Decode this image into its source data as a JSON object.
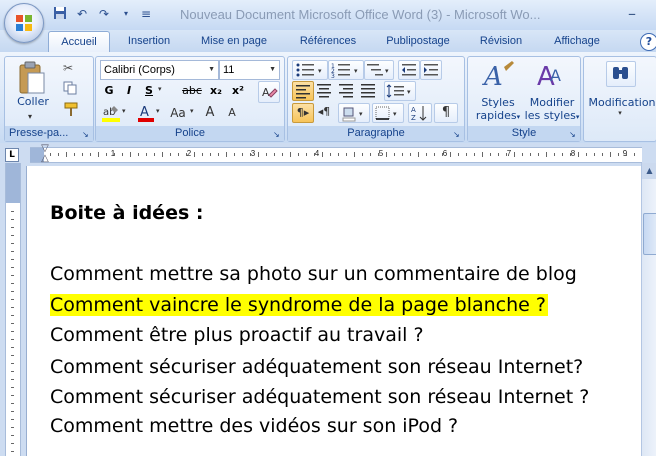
{
  "window": {
    "title": "Nouveau Document Microsoft Office Word (3) - Microsoft Wo...",
    "minimize": "–"
  },
  "quick_access": [
    "save-icon",
    "undo-icon",
    "redo-icon",
    "customize-icon"
  ],
  "tabs": [
    {
      "label": "Accueil",
      "active": true
    },
    {
      "label": "Insertion",
      "active": false
    },
    {
      "label": "Mise en page",
      "active": false
    },
    {
      "label": "Références",
      "active": false
    },
    {
      "label": "Publipostage",
      "active": false
    },
    {
      "label": "Révision",
      "active": false
    },
    {
      "label": "Affichage",
      "active": false
    }
  ],
  "help": "?",
  "ribbon": {
    "clipboard": {
      "label": "Presse-pa...",
      "paste": "Coller"
    },
    "font": {
      "label": "Police",
      "font_name": "Calibri (Corps)",
      "font_size": "11",
      "bold": "G",
      "italic": "I",
      "underline": "S",
      "strike": "abc",
      "subscript": "x₂",
      "superscript": "x²",
      "case": "Aa",
      "grow": "A",
      "shrink": "A"
    },
    "paragraph": {
      "label": "Paragraphe",
      "pilcrow": "¶"
    },
    "style": {
      "label": "Style",
      "quick_styles_1": "Styles",
      "quick_styles_2": "rapides",
      "modify_1": "Modifier",
      "modify_2": "les styles"
    },
    "editing": {
      "label": "Modification"
    }
  },
  "ruler": {
    "corner": "L",
    "numbers": [
      "1",
      "1",
      "2",
      "3",
      "4",
      "5",
      "6",
      "7",
      "8",
      "9"
    ]
  },
  "document": {
    "title": "Boite à idées :",
    "lines": [
      {
        "text": "Comment mettre sa photo sur un commentaire de blog",
        "highlight": false
      },
      {
        "text": "Comment vaincre  le syndrome de la page blanche ?",
        "highlight": true
      },
      {
        "text": "Comment être plus proactif au travail ?",
        "highlight": false
      },
      {
        "text": "Comment sécuriser adéquatement  son réseau Internet?",
        "highlight": false
      },
      {
        "text": "Comment sécuriser adéquatement  son réseau Internet ?",
        "highlight": false
      },
      {
        "text": "Comment mettre des vidéos sur son iPod ?",
        "highlight": false
      }
    ]
  },
  "colors": {
    "highlight": "#ffff00",
    "ribbon_text": "#15428b",
    "font_red": "#e00000"
  }
}
